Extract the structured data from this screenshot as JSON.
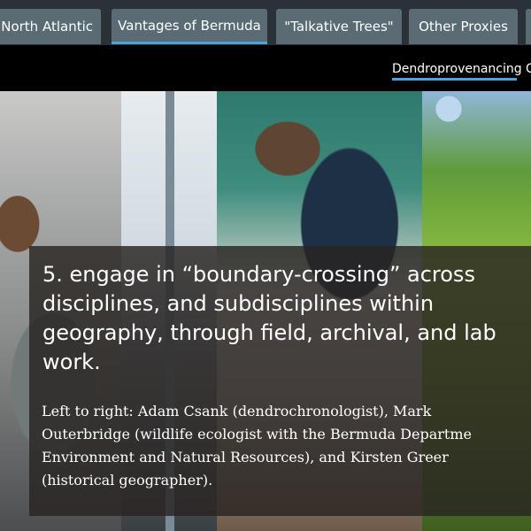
{
  "tabs": [
    {
      "label": "n North Atlantic"
    },
    {
      "label": "Vantages of Bermuda",
      "active": true
    },
    {
      "label": "\"Talkative Trees\""
    },
    {
      "label": "Other Proxies"
    },
    {
      "label": ""
    }
  ],
  "subnav": {
    "items": [
      {
        "label": "Dendroprovenancing",
        "active": true
      },
      {
        "label": "C"
      }
    ]
  },
  "caption": {
    "heading": "5. engage in “boundary-crossing” across disciplines, and subdisciplines within geography, through field, archival, and lab work.",
    "body_lines": [
      "Left to right: Adam Csank (dendrochronologist), Mark",
      "Outerbridge (wildlife ecologist with the Bermuda Departme",
      "Environment and Natural Resources), and Kirsten Greer",
      "(historical geographer)."
    ]
  },
  "colors": {
    "tab_bg": "#5a6b74",
    "tab_strip_bg": "#2b3237",
    "accent": "#4aa3df",
    "subnav_bg": "#000000",
    "caption_bg": "rgba(40,35,33,0.82)"
  },
  "photos": [
    {
      "name": "lab-photo-left"
    },
    {
      "name": "window-photo"
    },
    {
      "name": "microscope-photo"
    },
    {
      "name": "field-photo-right"
    }
  ]
}
